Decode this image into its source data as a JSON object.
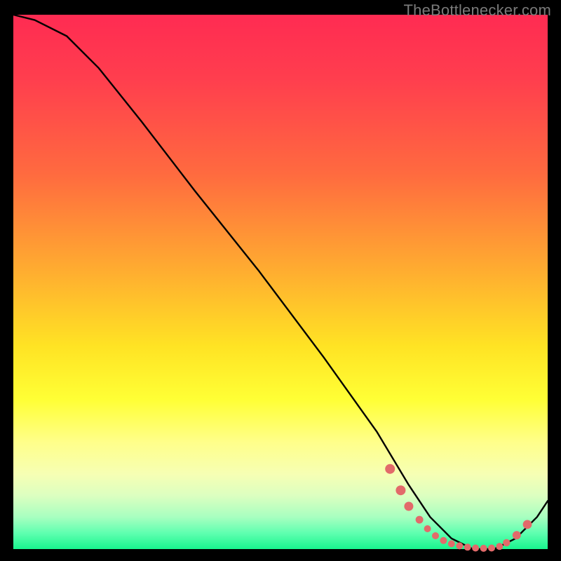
{
  "watermark": "TheBottlenecker.com",
  "colors": {
    "curve": "#000000",
    "marker_fill": "#e26a6a",
    "marker_stroke": "#c94f4f"
  },
  "chart_data": {
    "type": "line",
    "title": "",
    "xlabel": "",
    "ylabel": "",
    "xlim": [
      0,
      100
    ],
    "ylim": [
      0,
      100
    ],
    "grid": false,
    "series": [
      {
        "name": "curve",
        "x": [
          0,
          4,
          10,
          16,
          24,
          34,
          46,
          58,
          68,
          74,
          78,
          82,
          86,
          90,
          94,
          98,
          100
        ],
        "y": [
          100,
          99,
          96,
          90,
          80,
          67,
          52,
          36,
          22,
          12,
          6,
          2,
          0,
          0,
          2,
          6,
          9
        ]
      }
    ],
    "markers": {
      "name": "dense-segment",
      "x": [
        70.5,
        72.5,
        74,
        76,
        77.5,
        79,
        80.5,
        82,
        83.5,
        85,
        86.5,
        88,
        89.5,
        91,
        92.3,
        94.2,
        96.2
      ],
      "y": [
        15,
        11,
        8,
        5.5,
        3.8,
        2.5,
        1.6,
        1.0,
        0.6,
        0.35,
        0.2,
        0.15,
        0.2,
        0.5,
        1.2,
        2.6,
        4.6
      ],
      "r": [
        7,
        7,
        6.5,
        5.5,
        5,
        5,
        5,
        5,
        5,
        5,
        5,
        5,
        5,
        5,
        5.2,
        6.0,
        6.4
      ]
    }
  }
}
